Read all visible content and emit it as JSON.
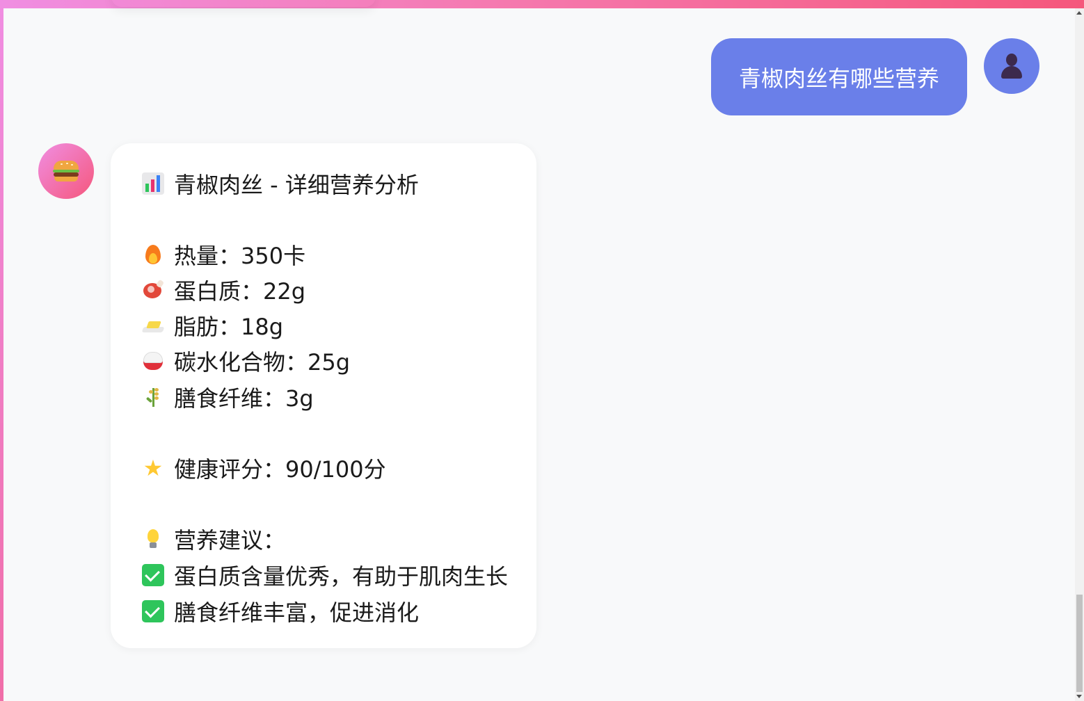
{
  "user_message": {
    "text": "青椒肉丝有哪些营养"
  },
  "bot_message": {
    "title": "青椒肉丝 - 详细营养分析",
    "nutrients": [
      {
        "icon": "fire-icon",
        "label": "热量：350卡"
      },
      {
        "icon": "meat-icon",
        "label": "蛋白质：22g"
      },
      {
        "icon": "butter-icon",
        "label": "脂肪：18g"
      },
      {
        "icon": "rice-bowl-icon",
        "label": "碳水化合物：25g"
      },
      {
        "icon": "grain-icon",
        "label": "膳食纤维：3g"
      }
    ],
    "health_score": "健康评分：90/100分",
    "advice_title": "营养建议：",
    "advice": [
      "蛋白质含量优秀，有助于肌肉生长",
      "膳食纤维丰富，促进消化"
    ]
  },
  "colors": {
    "user_bubble": "#6a7fe9",
    "accent_gradient_start": "#f08ee2",
    "accent_gradient_end": "#f5577c",
    "check": "#2ec55b"
  }
}
